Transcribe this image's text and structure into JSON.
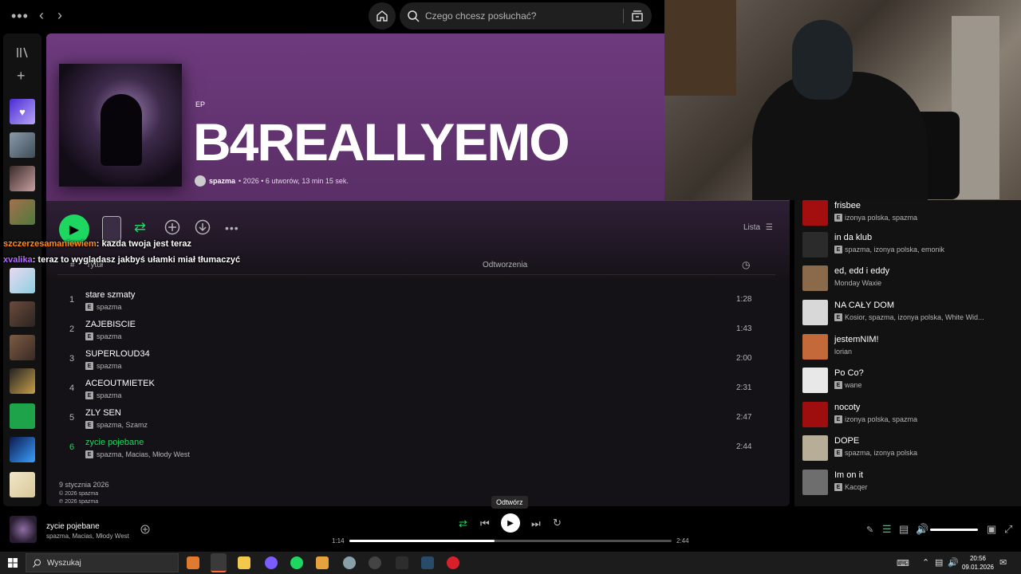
{
  "topbar": {
    "menu_icon": "more-horizontal-icon",
    "back_icon": "chevron-left-icon",
    "forward_icon": "chevron-right-icon",
    "home_icon": "home-icon",
    "search_placeholder": "Czego chcesz posłuchać?",
    "browse_icon": "browse-icon"
  },
  "album": {
    "type_label": "EP",
    "title": "B4REALLYEMO",
    "artist": "spazma",
    "meta_rest": "• 2026 • 6 utworów, 13 min 15 sek.",
    "list_view_label": "Lista",
    "release_date": "9 stycznia 2026",
    "copyright_c": "© 2026 spazma",
    "copyright_p": "℗ 2026 spazma"
  },
  "columns": {
    "hash": "#",
    "title": "Tytuł",
    "plays": "Odtworzenia"
  },
  "tracks": [
    {
      "num": "1",
      "name": "stare szmaty",
      "artists": "spazma",
      "duration": "1:28"
    },
    {
      "num": "2",
      "name": "ZAJEBISCIE",
      "artists": "spazma",
      "duration": "1:43"
    },
    {
      "num": "3",
      "name": "SUPERLOUD34",
      "artists": "spazma",
      "duration": "2:00"
    },
    {
      "num": "4",
      "name": "ACEOUTMIETEK",
      "artists": "spazma",
      "duration": "2:31"
    },
    {
      "num": "5",
      "name": "ZLY SEN",
      "artists": "spazma, Szamz",
      "duration": "2:47"
    },
    {
      "num": "6",
      "name": "zycie pojebane",
      "artists": "spazma, Macias, Młody West",
      "duration": "2:44"
    }
  ],
  "explicit_badge": "E",
  "chat": [
    {
      "user": "szczerzesamaniewiem",
      "message": ": kazda twoja jest teraz"
    },
    {
      "user": "xvalika",
      "message": ": teraz to wyglądasz jakbyś ułamki miał tłumaczyć"
    }
  ],
  "queue": [
    {
      "title": "frisbee",
      "artists": "izonya polska, spazma",
      "explicit": true,
      "color": "#a30f0f"
    },
    {
      "title": "in da klub",
      "artists": "spazma, izonya polska, emonik",
      "explicit": true,
      "color": "#2b2b2b"
    },
    {
      "title": "ed, edd i eddy",
      "artists": "Monday Waxie",
      "explicit": false,
      "color": "#8a6a4a"
    },
    {
      "title": "NA CAŁY DOM",
      "artists": "Kosior, spazma, izonya polska, White Wid...",
      "explicit": true,
      "color": "#d8d8d8"
    },
    {
      "title": "jestemNIM!",
      "artists": "lorian",
      "explicit": false,
      "color": "#c46a3a"
    },
    {
      "title": "Po Co?",
      "artists": "wane",
      "explicit": true,
      "color": "#e8e8e8"
    },
    {
      "title": "nocoty",
      "artists": "izonya polska, spazma",
      "explicit": true,
      "color": "#9e0e0e"
    },
    {
      "title": "DOPE",
      "artists": "spazma, izonya polska",
      "explicit": true,
      "color": "#b8ad96"
    },
    {
      "title": "Im on it",
      "artists": "Kacqer",
      "explicit": true,
      "color": "#6e6e6e"
    }
  ],
  "player": {
    "now_playing_title": "zycie pojebane",
    "now_playing_artists": "spazma, Macias, Młody West",
    "tooltip": "Odtwórz",
    "elapsed": "1:14",
    "total": "2:44",
    "progress": 0.45,
    "volume": 1.0
  },
  "taskbar": {
    "search_placeholder": "Wyszukaj",
    "time": "20:56",
    "date": "09.01.2026"
  }
}
